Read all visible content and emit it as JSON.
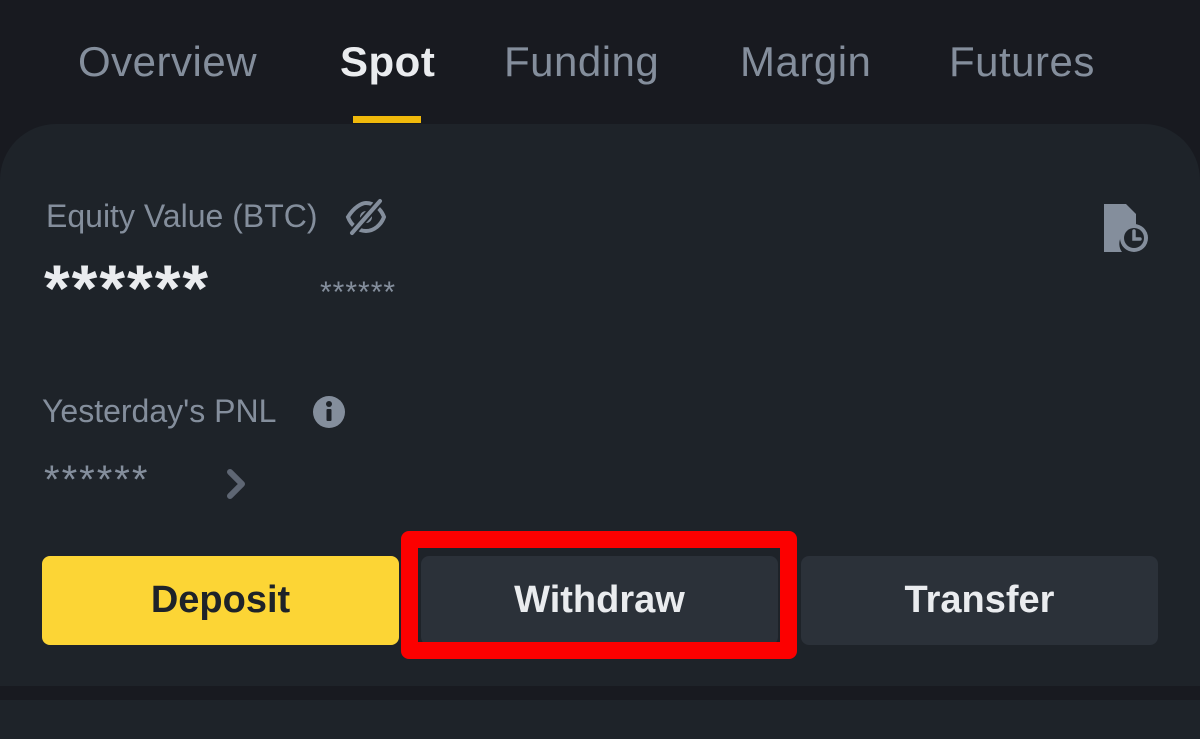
{
  "tabs": [
    {
      "label": "Overview",
      "active": false
    },
    {
      "label": "Spot",
      "active": true
    },
    {
      "label": "Funding",
      "active": false
    },
    {
      "label": "Margin",
      "active": false
    },
    {
      "label": "Futures",
      "active": false
    }
  ],
  "equity": {
    "label": "Equity Value (BTC)",
    "value": "******",
    "sub_value": "******"
  },
  "pnl": {
    "label": "Yesterday's PNL",
    "value": "******"
  },
  "actions": {
    "deposit_label": "Deposit",
    "withdraw_label": "Withdraw",
    "transfer_label": "Transfer"
  },
  "colors": {
    "background": "#181a20",
    "card": "#1e2329",
    "accent": "#f0b90b",
    "deposit_button": "#fcd535",
    "secondary_button": "#2b3139",
    "highlight": "#fc0000",
    "muted_text": "#848e9c",
    "primary_text": "#eaecef"
  },
  "icons": [
    "eye-off-icon",
    "history-icon",
    "info-icon",
    "chevron-right-icon"
  ]
}
